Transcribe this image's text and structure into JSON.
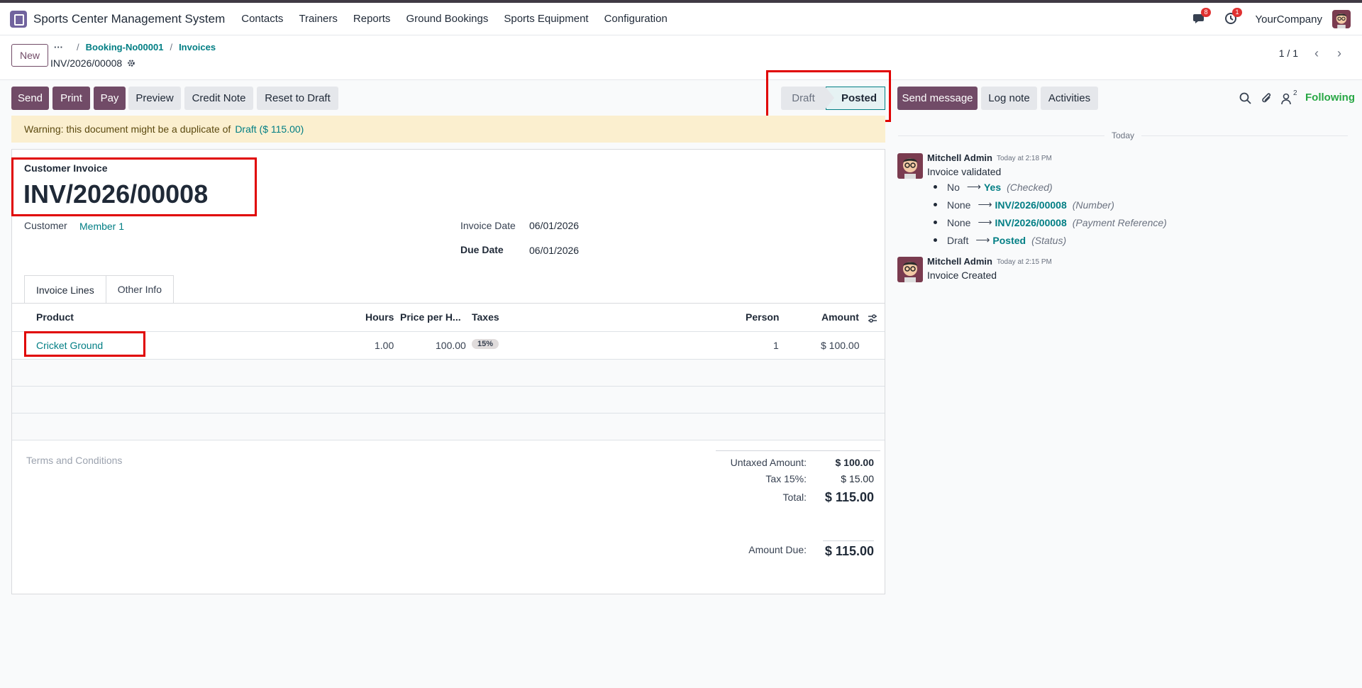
{
  "navbar": {
    "app_name": "Sports Center Management System",
    "menu": [
      "Contacts",
      "Trainers",
      "Reports",
      "Ground Bookings",
      "Sports Equipment",
      "Configuration"
    ],
    "messages_count": "8",
    "activities_count": "1",
    "company": "YourCompany"
  },
  "control_panel": {
    "new_label": "New",
    "breadcrumb": [
      "Booking-No00001",
      "Invoices"
    ],
    "record_name": "INV/2026/00008",
    "pager": "1 / 1"
  },
  "actions": {
    "send": "Send",
    "print": "Print",
    "pay": "Pay",
    "preview": "Preview",
    "credit_note": "Credit Note",
    "reset_to_draft": "Reset to Draft"
  },
  "status": {
    "draft": "Draft",
    "posted": "Posted"
  },
  "warning": {
    "text": "Warning: this document might be a duplicate of",
    "link": "Draft ($ 115.00)"
  },
  "invoice": {
    "type_label": "Customer Invoice",
    "name": "INV/2026/00008",
    "customer_label": "Customer",
    "customer": "Member 1",
    "invoice_date_label": "Invoice Date",
    "invoice_date": "06/01/2026",
    "due_date_label": "Due Date",
    "due_date": "06/01/2026"
  },
  "tabs": [
    "Invoice Lines",
    "Other Info"
  ],
  "lines": {
    "headers": {
      "product": "Product",
      "hours": "Hours",
      "price": "Price per H...",
      "taxes": "Taxes",
      "person": "Person",
      "amount": "Amount"
    },
    "rows": [
      {
        "product": "Cricket Ground",
        "hours": "1.00",
        "price": "100.00",
        "tax": "15%",
        "person": "1",
        "amount": "$ 100.00"
      }
    ]
  },
  "totals": {
    "terms_placeholder": "Terms and Conditions",
    "untaxed_label": "Untaxed Amount:",
    "untaxed": "$ 100.00",
    "tax_label": "Tax 15%:",
    "tax": "$ 15.00",
    "total_label": "Total:",
    "total": "$ 115.00",
    "due_label": "Amount Due:",
    "due": "$ 115.00"
  },
  "chatter": {
    "send_message": "Send message",
    "log_note": "Log note",
    "activities": "Activities",
    "followers_count": "2",
    "following": "Following",
    "today": "Today",
    "messages": [
      {
        "author": "Mitchell Admin",
        "date": "Today at 2:18 PM",
        "body": "Invoice validated",
        "tracking": [
          {
            "old": "No",
            "new": "Yes",
            "field": "(Checked)"
          },
          {
            "old": "None",
            "new": "INV/2026/00008",
            "field": "(Number)"
          },
          {
            "old": "None",
            "new": "INV/2026/00008",
            "field": "(Payment Reference)"
          },
          {
            "old": "Draft",
            "new": "Posted",
            "field": "(Status)"
          }
        ]
      },
      {
        "author": "Mitchell Admin",
        "date": "Today at 2:15 PM",
        "body": "Invoice Created"
      }
    ]
  },
  "colors": {
    "brand": "#714b67",
    "link": "#017e84",
    "highlight": "#e00000",
    "warning_bg": "#fbefcf",
    "following": "#28a745"
  }
}
